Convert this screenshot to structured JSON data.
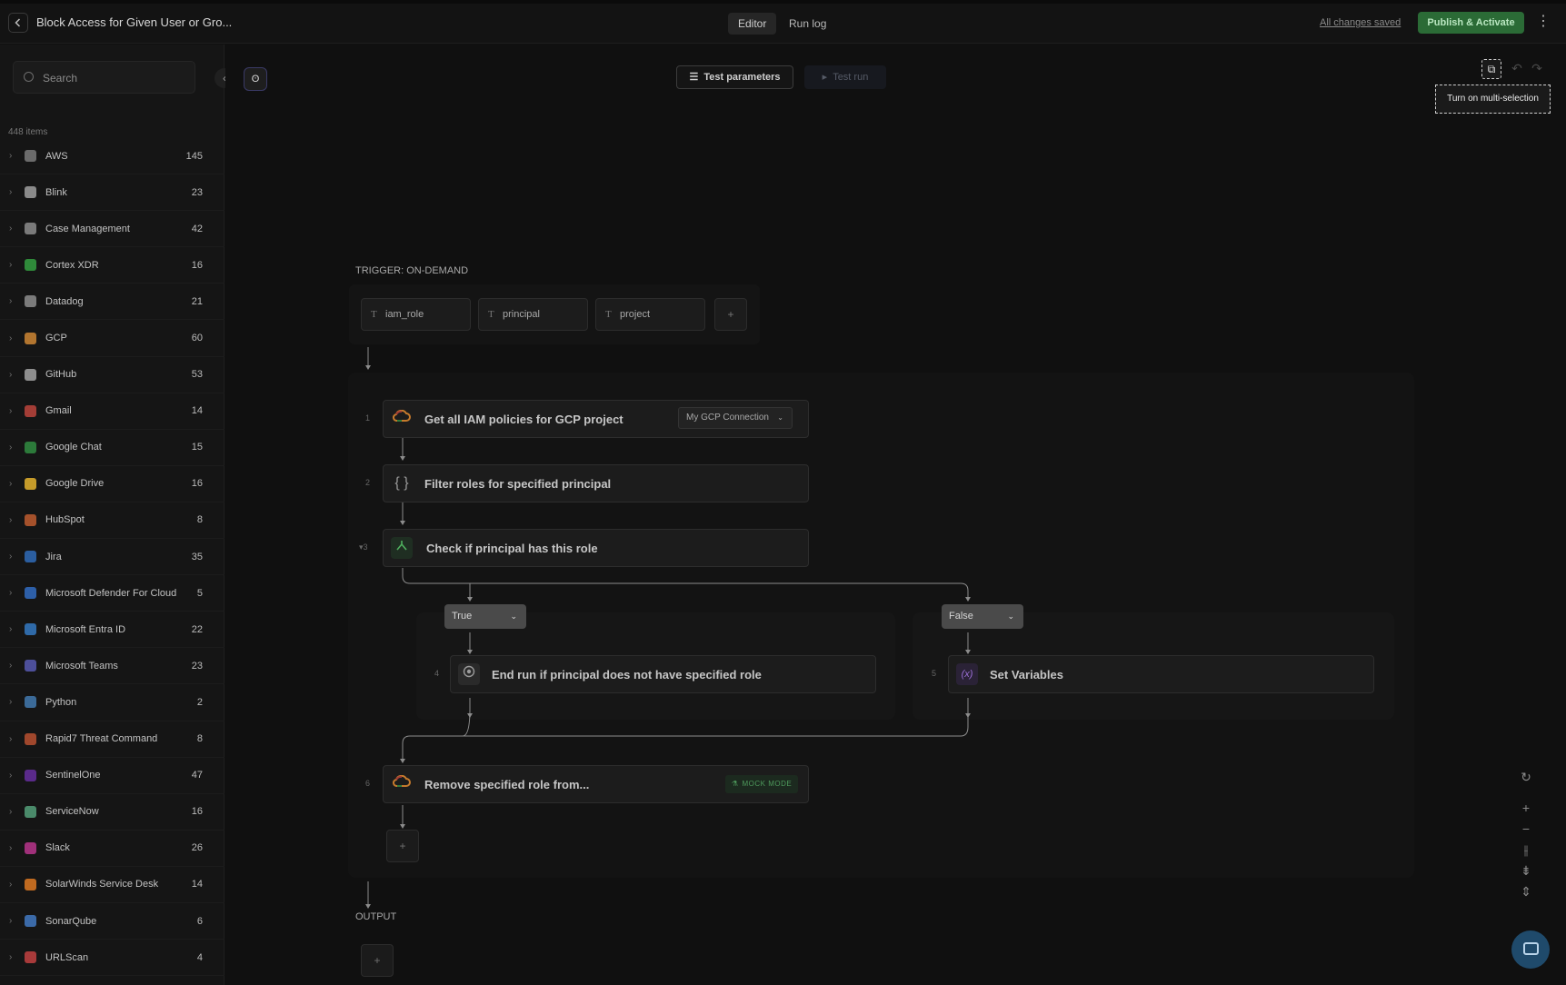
{
  "header": {
    "title": "Block Access for Given User or Gro...",
    "tabs": [
      {
        "label": "Editor",
        "active": true
      },
      {
        "label": "Run log",
        "active": false
      }
    ],
    "saved_label": "All changes saved",
    "publish_label": "Publish & Activate"
  },
  "sidebar": {
    "search_placeholder": "Search",
    "items_count": "448 items",
    "categories": [
      {
        "label": "AWS",
        "count": "145",
        "icon": "aws-icon",
        "color": "#6b6b6b"
      },
      {
        "label": "Blink",
        "count": "23",
        "icon": "blink-icon",
        "color": "#8a8a8a"
      },
      {
        "label": "Case Management",
        "count": "42",
        "icon": "case-icon",
        "color": "#7a7a7a"
      },
      {
        "label": "Cortex XDR",
        "count": "16",
        "icon": "cortex-icon",
        "color": "#2f8a3a"
      },
      {
        "label": "Datadog",
        "count": "21",
        "icon": "datadog-icon",
        "color": "#7b7b7b"
      },
      {
        "label": "GCP",
        "count": "60",
        "icon": "gcp-icon",
        "color": "#b2752f"
      },
      {
        "label": "GitHub",
        "count": "53",
        "icon": "github-icon",
        "color": "#8e8e8e"
      },
      {
        "label": "Gmail",
        "count": "14",
        "icon": "gmail-icon",
        "color": "#a33d36"
      },
      {
        "label": "Google Chat",
        "count": "15",
        "icon": "google-chat-icon",
        "color": "#2c7a3a"
      },
      {
        "label": "Google Drive",
        "count": "16",
        "icon": "google-drive-icon",
        "color": "#c59b2a"
      },
      {
        "label": "HubSpot",
        "count": "8",
        "icon": "hubspot-icon",
        "color": "#a5512b"
      },
      {
        "label": "Jira",
        "count": "35",
        "icon": "jira-icon",
        "color": "#2b5ea0"
      },
      {
        "label": "Microsoft Defender For Cloud",
        "count": "5",
        "icon": "defender-icon",
        "color": "#2d5fa8"
      },
      {
        "label": "Microsoft Entra ID",
        "count": "22",
        "icon": "entra-icon",
        "color": "#2f6aa8"
      },
      {
        "label": "Microsoft Teams",
        "count": "23",
        "icon": "teams-icon",
        "color": "#4d4f9a"
      },
      {
        "label": "Python",
        "count": "2",
        "icon": "python-icon",
        "color": "#3b6a98"
      },
      {
        "label": "Rapid7 Threat Command",
        "count": "8",
        "icon": "rapid7-icon",
        "color": "#a0472c"
      },
      {
        "label": "SentinelOne",
        "count": "47",
        "icon": "sentinelone-icon",
        "color": "#5a2a8a"
      },
      {
        "label": "ServiceNow",
        "count": "16",
        "icon": "servicenow-icon",
        "color": "#4a8a6a"
      },
      {
        "label": "Slack",
        "count": "26",
        "icon": "slack-icon",
        "color": "#a0307a"
      },
      {
        "label": "SolarWinds Service Desk",
        "count": "14",
        "icon": "solarwinds-icon",
        "color": "#c06a20"
      },
      {
        "label": "SonarQube",
        "count": "6",
        "icon": "sonarqube-icon",
        "color": "#3b6aa8"
      },
      {
        "label": "URLScan",
        "count": "4",
        "icon": "urlscan-icon",
        "color": "#a83a3a"
      }
    ]
  },
  "toolbar": {
    "test_parameters_label": "Test parameters",
    "test_run_label": "Test run",
    "tooltip": "Turn on multi-selection"
  },
  "trigger": {
    "label": "TRIGGER: ON-DEMAND",
    "params": [
      "iam_role",
      "principal",
      "project"
    ],
    "add_label": "+"
  },
  "steps": [
    {
      "num": "1",
      "title": "Get all IAM policies for GCP project",
      "connection": "My GCP Connection"
    },
    {
      "num": "2",
      "title": "Filter roles for specified principal"
    },
    {
      "num": "3",
      "title": "Check if principal has this role"
    },
    {
      "num": "4",
      "title": "End run if principal does not have specified role"
    },
    {
      "num": "5",
      "title": "Set Variables"
    },
    {
      "num": "6",
      "title": "Remove specified role from...",
      "badge": "MOCK MODE"
    }
  ],
  "branches": {
    "true_label": "True",
    "false_label": "False"
  },
  "output": {
    "label": "OUTPUT",
    "add_label": "+"
  },
  "add_step_label": "+"
}
